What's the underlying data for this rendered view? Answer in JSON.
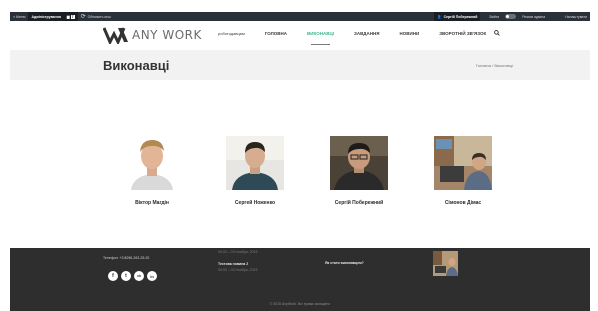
{
  "admin_bar": {
    "menu": "≡ Меню",
    "admin_panel": "Адміністрування",
    "count": "7",
    "refresh": "Обновить кеш",
    "user": "Сергій Побережний",
    "exit": "Вийти",
    "toggle_label": "Режим адміна",
    "settings": "Налаштувати"
  },
  "header": {
    "logo_text": "ANY WORK",
    "nav": [
      "роботодавцям",
      "ГОЛОВНА",
      "ВИКОНАВЦІ",
      "ЗАВДАННЯ",
      "НОВИНИ",
      "ЗВОРОТНІЙ ЗВ'ЯЗОК"
    ],
    "active_index": 2
  },
  "title_bar": {
    "title": "Виконавці",
    "breadcrumb": "Головна / Виконавці"
  },
  "performers": [
    {
      "name": "Віктор Магдін"
    },
    {
      "name": "Сергей Ноженко"
    },
    {
      "name": "Сергій Побережний"
    },
    {
      "name": "Сімонов Дімас"
    }
  ],
  "footer": {
    "phone": "Телефон: +3 8096-263-25-92",
    "social": [
      "f",
      "t",
      "vk",
      "in"
    ],
    "news_date_1": "00:00 – 03 Ноября, 2015",
    "news_title_2": "Тестова новина 2",
    "news_date_2": "00:00 – 03 Ноября, 2015",
    "link": "Як стати виконавцем?",
    "copyright": "© 2015 AnyWork. Всі права захищено"
  },
  "colors": {
    "accent": "#3fb68b",
    "admin_bar": "#2b3138",
    "footer": "#2e2e2e"
  }
}
